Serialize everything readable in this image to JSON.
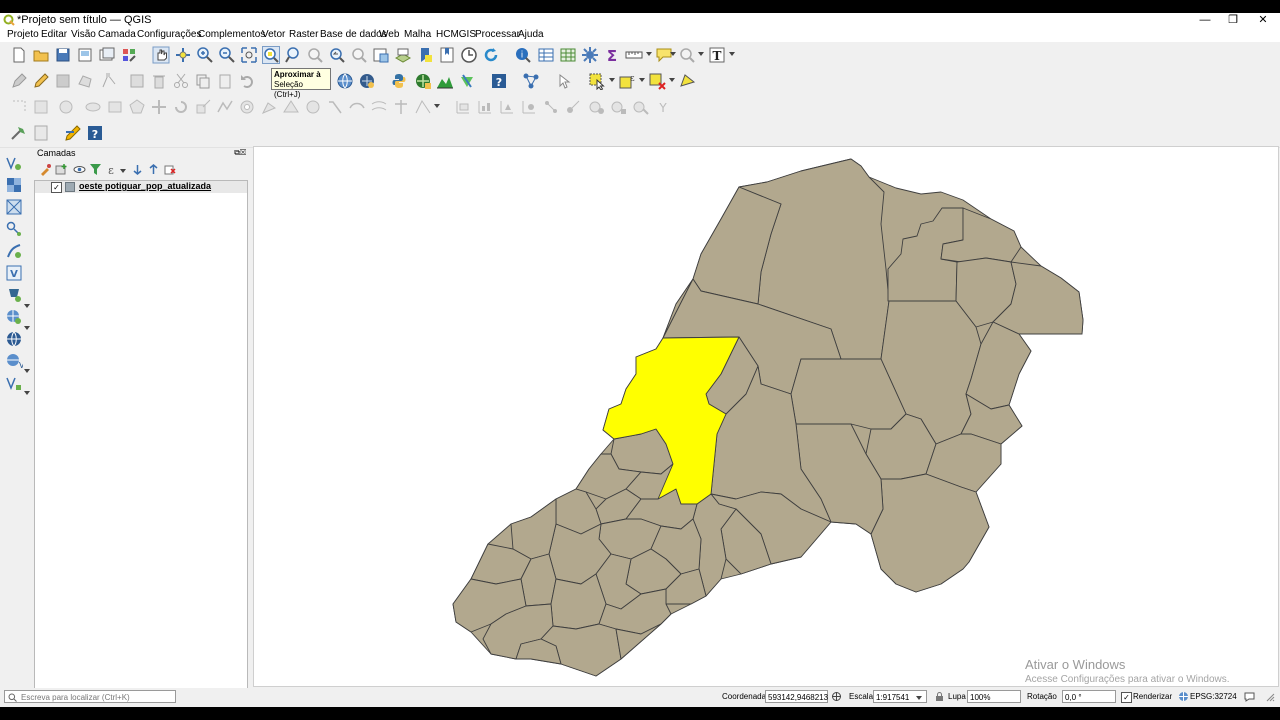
{
  "window": {
    "title": "*Projeto sem título — QGIS",
    "minimize": "—",
    "restore": "❐",
    "close": "✕"
  },
  "menu": [
    "Projeto",
    "Editar",
    "Visão",
    "Camada",
    "Configurações",
    "Complementos",
    "Vetor",
    "Raster",
    "Base de dados",
    "Web",
    "Malha",
    "HCMGIS",
    "Processar",
    "Ajuda"
  ],
  "tooltip": {
    "line1": "Aproximar à",
    "line2": "Seleção (Ctrl+J)"
  },
  "layers_panel": {
    "title": "Camadas",
    "layer_name": "oeste potiguar_pop_atualizada",
    "layer_checked": "✓"
  },
  "map": {
    "fill_color": "#b2a88e",
    "selected_color": "#ffff00",
    "stroke_color": "#3f3f3f"
  },
  "watermark": {
    "line1": "Ativar o Windows",
    "line2": "Acesse Configurações para ativar o Windows."
  },
  "statusbar": {
    "search_placeholder": "Escreva para localizar (Ctrl+K)",
    "coord_label": "Coordenada",
    "coord_value": "593142,9468213",
    "scale_label": "Escala",
    "scale_value": "1:917541",
    "magnifier_label": "Lupa",
    "magnifier_value": "100%",
    "rotation_label": "Rotação",
    "rotation_value": "0,0 °",
    "render_label": "Renderizar",
    "render_checked": "✓",
    "crs": "EPSG:32724"
  }
}
